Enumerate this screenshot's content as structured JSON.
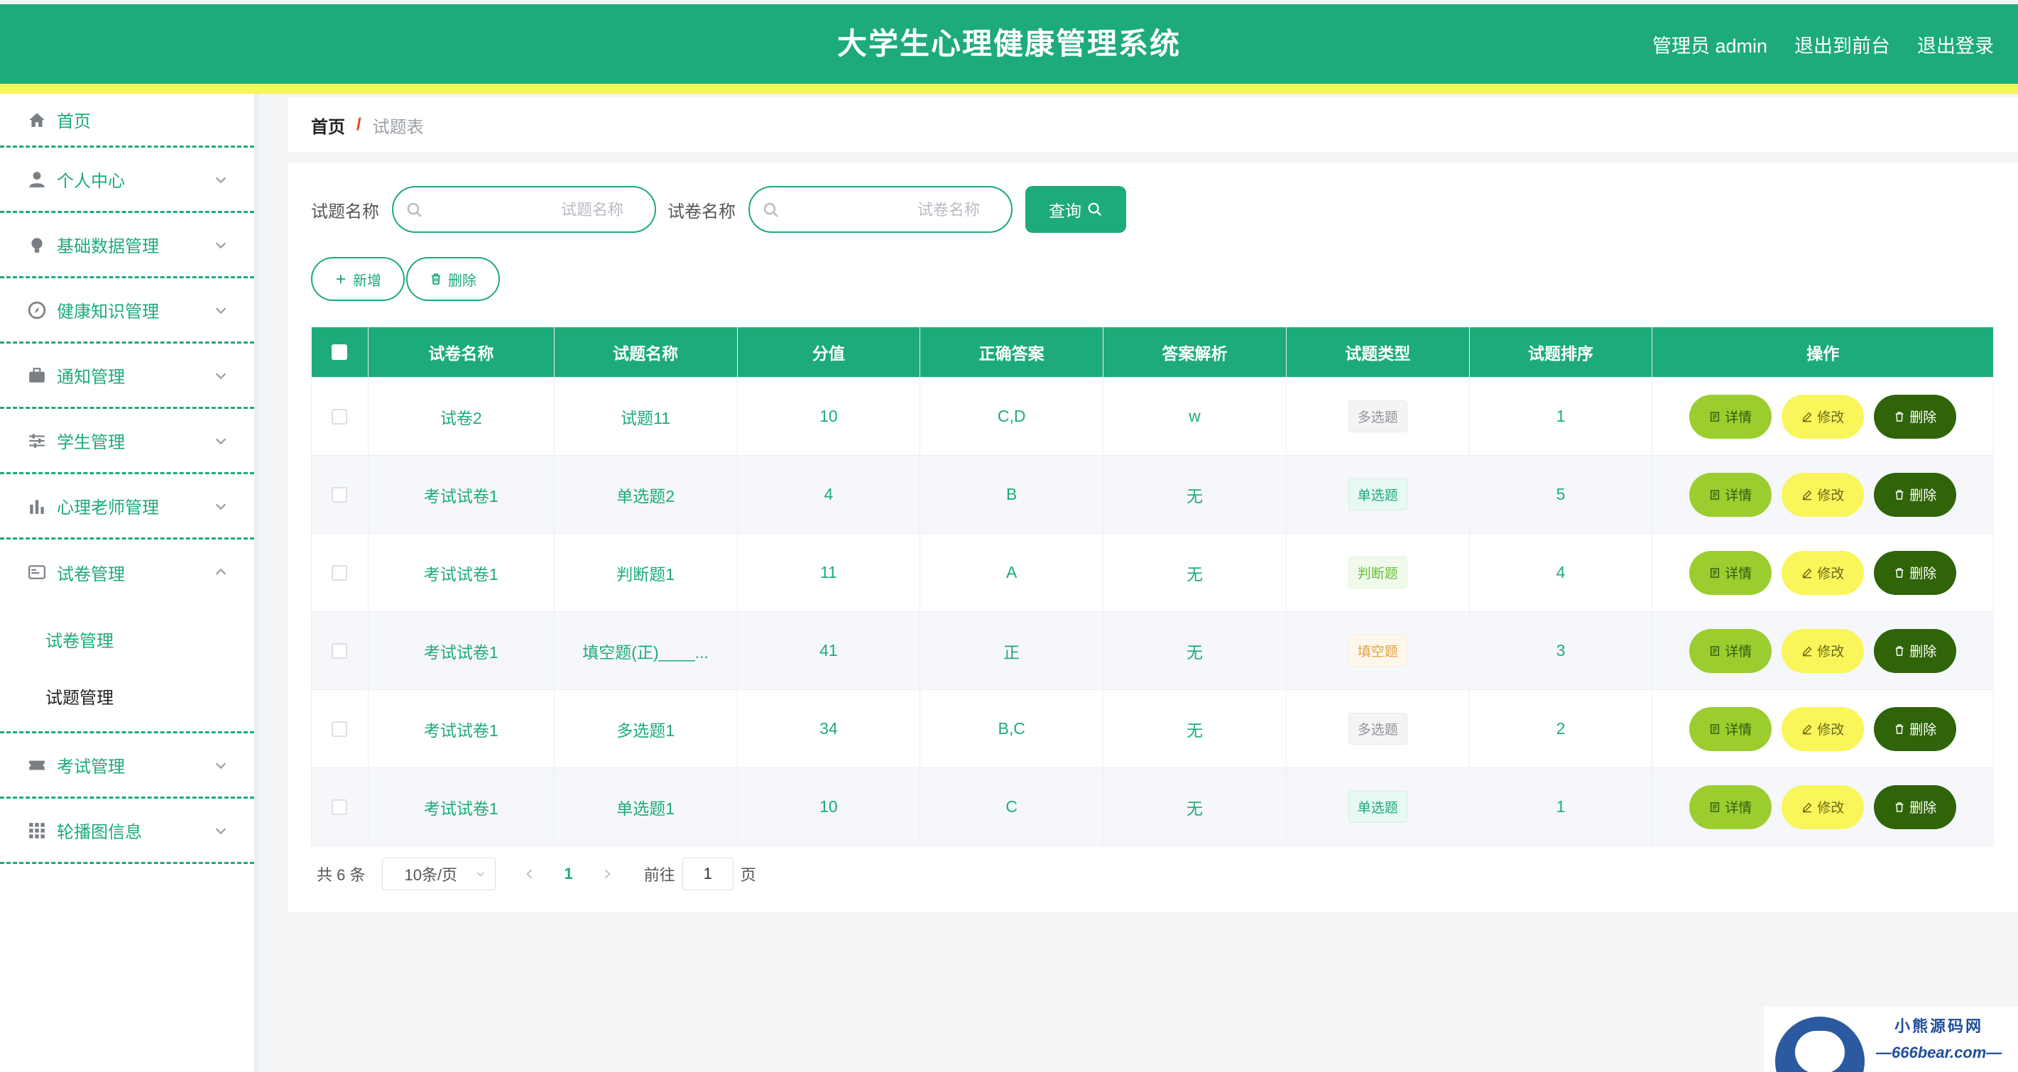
{
  "header": {
    "title": "大学生心理健康管理系统",
    "user": "管理员 admin",
    "to_front": "退出到前台",
    "logout": "退出登录"
  },
  "sidebar": {
    "items": [
      {
        "label": "首页",
        "icon": "home-icon"
      },
      {
        "label": "个人中心",
        "icon": "user-icon"
      },
      {
        "label": "基础数据管理",
        "icon": "bulb-icon"
      },
      {
        "label": "健康知识管理",
        "icon": "compass-icon"
      },
      {
        "label": "通知管理",
        "icon": "briefcase-icon"
      },
      {
        "label": "学生管理",
        "icon": "sliders-icon"
      },
      {
        "label": "心理老师管理",
        "icon": "bar-chart-icon"
      },
      {
        "label": "试卷管理",
        "icon": "card-icon"
      },
      {
        "label": "考试管理",
        "icon": "ticket-icon"
      },
      {
        "label": "轮播图信息",
        "icon": "grid-icon"
      }
    ],
    "sub_items": [
      {
        "label": "试卷管理"
      },
      {
        "label": "试题管理"
      }
    ]
  },
  "breadcrumb": {
    "home": "首页",
    "sep": "/",
    "current": "试题表"
  },
  "search": {
    "label1": "试题名称",
    "placeholder1": "试题名称",
    "label2": "试卷名称",
    "placeholder2": "试卷名称",
    "query": "查询"
  },
  "actions": {
    "add": "新增",
    "delete": "删除"
  },
  "table": {
    "headers": [
      "试卷名称",
      "试题名称",
      "分值",
      "正确答案",
      "答案解析",
      "试题类型",
      "试题排序",
      "操作"
    ],
    "rows": [
      {
        "paper": "试卷2",
        "question": "试题11",
        "score": "10",
        "answer": "C,D",
        "explain": "w",
        "type": "多选题",
        "order": "1"
      },
      {
        "paper": "考试试卷1",
        "question": "单选题2",
        "score": "4",
        "answer": "B",
        "explain": "无",
        "type": "单选题",
        "order": "5"
      },
      {
        "paper": "考试试卷1",
        "question": "判断题1",
        "score": "11",
        "answer": "A",
        "explain": "无",
        "type": "判断题",
        "order": "4"
      },
      {
        "paper": "考试试卷1",
        "question": "填空题(正)____...",
        "score": "41",
        "answer": "正",
        "explain": "无",
        "type": "填空题",
        "order": "3"
      },
      {
        "paper": "考试试卷1",
        "question": "多选题1",
        "score": "34",
        "answer": "B,C",
        "explain": "无",
        "type": "多选题",
        "order": "2"
      },
      {
        "paper": "考试试卷1",
        "question": "单选题1",
        "score": "10",
        "answer": "C",
        "explain": "无",
        "type": "单选题",
        "order": "1"
      }
    ],
    "op_detail": "详情",
    "op_edit": "修改",
    "op_delete": "删除"
  },
  "pagination": {
    "total": "共 6 条",
    "page_size": "10条/页",
    "current_page": "1",
    "goto_label": "前往",
    "goto_value": "1",
    "page_unit": "页"
  },
  "watermark": {
    "line1": "小熊源码网",
    "line2": "—666bear.com—"
  },
  "colors": {
    "primary": "#1dab79",
    "stripe": "#f6f55a",
    "detail": "#9bcd2e",
    "edit": "#f8f65a",
    "delete": "#2f6408"
  }
}
